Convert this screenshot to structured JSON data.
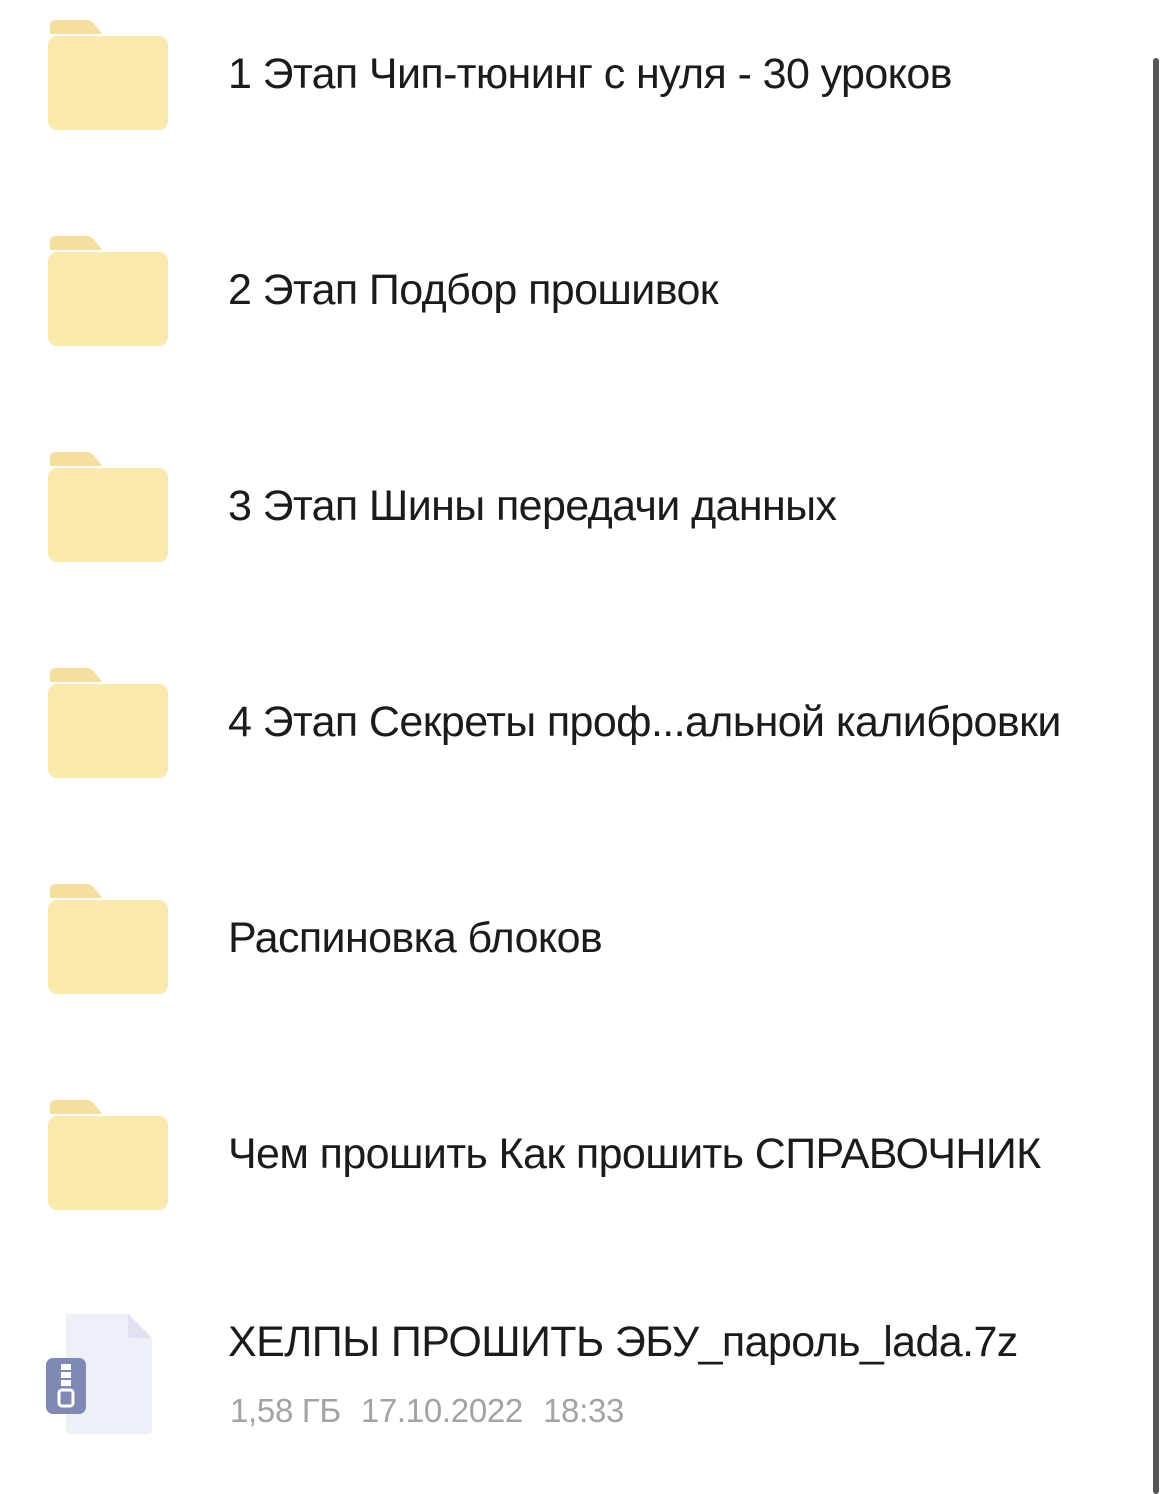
{
  "colors": {
    "folder_body": "#fbeaae",
    "folder_tab": "#f5dfa0",
    "archive_doc": "#eef0f8",
    "archive_badge": "#8088b4",
    "name_text": "#1b1b1b",
    "meta_text": "#a3a3a3"
  },
  "items": [
    {
      "type": "folder",
      "icon": "folder-icon",
      "name": "1 Этап Чип-тюнинг с нуля - 30 уроков"
    },
    {
      "type": "folder",
      "icon": "folder-icon",
      "name": "2 Этап Подбор прошивок"
    },
    {
      "type": "folder",
      "icon": "folder-icon",
      "name": "3 Этап Шины передачи данных"
    },
    {
      "type": "folder",
      "icon": "folder-icon",
      "name": "4 Этап Секреты проф...альной калибровки"
    },
    {
      "type": "folder",
      "icon": "folder-icon",
      "name": "Распиновка блоков"
    },
    {
      "type": "folder",
      "icon": "folder-icon",
      "name": "Чем прошить Как прошить СПРАВОЧНИК"
    },
    {
      "type": "file",
      "icon": "archive-file-icon",
      "name": "ХЕЛПЫ ПРОШИТЬ ЭБУ_пароль_lada.7z",
      "size": "1,58 ГБ",
      "date": "17.10.2022",
      "time": "18:33"
    }
  ]
}
